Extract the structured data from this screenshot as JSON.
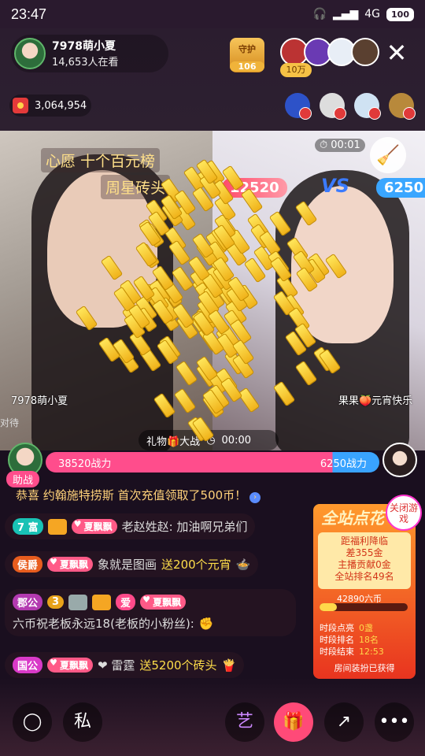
{
  "status": {
    "time": "23:47",
    "network": "4G",
    "battery": "100"
  },
  "host": {
    "name": "7978萌小夏",
    "viewers": "14,653人在看"
  },
  "guard": {
    "label": "守护",
    "count": "106"
  },
  "top_fans_total": "10万",
  "coins": "3,064,954",
  "stream": {
    "wish_line1": "心愿 十个百元榜",
    "wish_line2": "周星砖头",
    "timer": "00:01",
    "pk_left": "12520",
    "vs": "VS",
    "pk_right": "6250",
    "cam_left_name": "7978萌小夏",
    "cam_right_name": "果果🍑元宵快乐",
    "waiting": "对待",
    "giftwar": "礼物🎁大战",
    "giftwar_time": "00:00"
  },
  "battle": {
    "left": "38520战力",
    "right": "6250战力",
    "helper": "助战",
    "left_ratio": 0.86
  },
  "chat": {
    "system": "恭喜 约翰施特捞斯 首次充值领取了500币！",
    "rows": [
      {
        "badge": "7 富",
        "fan": "夏飘飘",
        "text": "老赵姓赵: 加油啊兄弟们"
      },
      {
        "badge": "侯爵",
        "fan": "夏飘飘",
        "user": "象就是图画",
        "gift": "送200个元宵"
      },
      {
        "badge": "郡公",
        "num": "3",
        "ai": "爱",
        "fan": "夏飘飘",
        "text": "六币祝老板永远18(老板的小粉丝):",
        "emoji": "✊"
      },
      {
        "badge": "国公",
        "fan": "夏飘飘",
        "user": "❤ 雷霆",
        "gift": "送5200个砖头"
      }
    ]
  },
  "rank_panel": {
    "title": "全站点花",
    "line1": "距福利降临",
    "line2": "差355金",
    "line3": "主播贡献0金",
    "line4": "全站排名49名",
    "progress_text": "42890六币",
    "progress": 0.2,
    "stats": [
      {
        "label": "时段点亮",
        "value": "0盏"
      },
      {
        "label": "时段排名",
        "value": "18名"
      },
      {
        "label": "时段结束",
        "value": "12:53"
      }
    ],
    "foot": "房间装扮已获得",
    "close_game": "关闭游戏"
  },
  "bottom": {
    "chat": "chat-bubble-icon",
    "private": "私",
    "art": "艺",
    "gift": "gift-icon",
    "share": "share-icon",
    "more": "more-icon"
  },
  "colors": {
    "pink": "#ff4d8c",
    "blue": "#39a3ff",
    "gold": "#ffde4a",
    "orange": "#e8341f"
  }
}
